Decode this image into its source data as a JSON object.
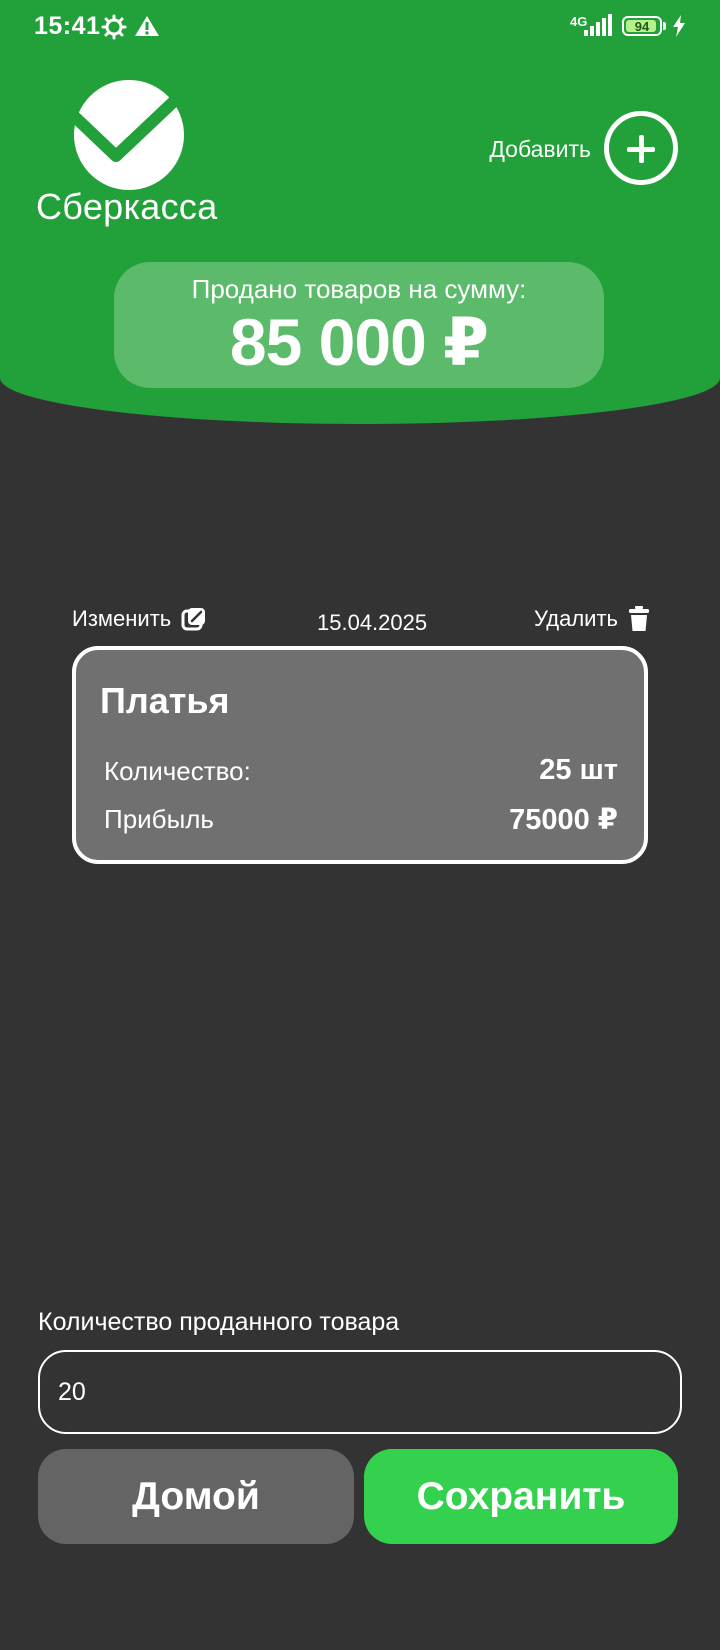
{
  "status_bar": {
    "time": "15:41",
    "network": "4G",
    "battery": "94",
    "battery_level": 0.94,
    "icons": [
      "gear-icon",
      "warning-icon",
      "signal-icon",
      "battery-icon",
      "charging-icon"
    ]
  },
  "header": {
    "brand": "Сберкасса",
    "add_label": "Добавить",
    "background_color": "#22A03A"
  },
  "summary": {
    "label": "Продано товаров на сумму:",
    "value": "85 000 ₽"
  },
  "item": {
    "edit_label": "Изменить",
    "date": "15.04.2025",
    "delete_label": "Удалить",
    "name": "Платья",
    "quantity_label": "Количество:",
    "quantity_value": "25 шт",
    "profit_label": "Прибыль",
    "profit_value": "75000 ₽"
  },
  "form": {
    "quantity_label": "Количество проданного товара",
    "quantity_value": "20"
  },
  "buttons": {
    "home": "Домой",
    "save": "Сохранить",
    "save_color": "#33D14E"
  }
}
